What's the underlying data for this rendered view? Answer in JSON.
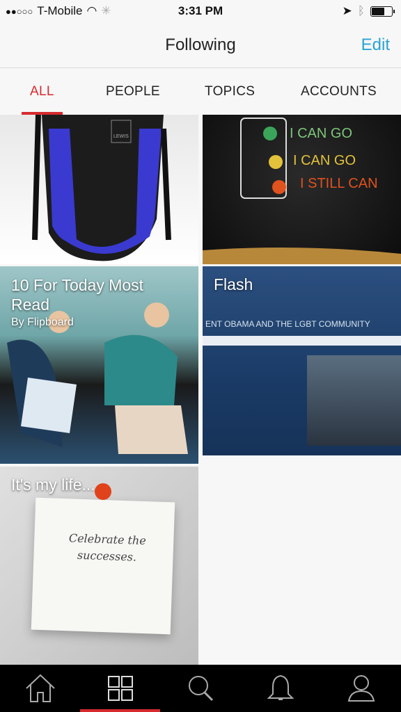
{
  "status_bar": {
    "carrier": "T-Mobile",
    "signal": "●●○○○",
    "time": "3:31 PM",
    "battery_level": 0.65
  },
  "header": {
    "title": "Following",
    "edit_label": "Edit",
    "accent": "#2aa3d6"
  },
  "tabs": [
    {
      "label": "ALL",
      "active": true
    },
    {
      "label": "PEOPLE"
    },
    {
      "label": "TOPICS"
    },
    {
      "label": "ACCOUNTS"
    }
  ],
  "tab_accent": "#d62a2f",
  "tiles": [
    {
      "title": "",
      "image": "backpack",
      "image_text": "LEWIS"
    },
    {
      "title": "",
      "image": "traffic-light-shirt",
      "image_text": [
        "I CAN GO",
        "I CAN GO",
        "I STILL CAN"
      ]
    },
    {
      "title": "10 For Today Most Read",
      "subtitle": "By Flipboard",
      "image": "illustration-car"
    },
    {
      "title": "Flash",
      "image": "whitehouse-page",
      "image_text": "ENT OBAMA AND THE LGBT COMMUNITY"
    },
    {
      "title": "It's my life...",
      "image": "sticky-note",
      "image_text": "Celebrate the successes."
    }
  ],
  "bottom_nav": [
    {
      "icon": "home-icon"
    },
    {
      "icon": "grid-icon",
      "active": true
    },
    {
      "icon": "search-icon"
    },
    {
      "icon": "bell-icon"
    },
    {
      "icon": "profile-icon"
    }
  ]
}
